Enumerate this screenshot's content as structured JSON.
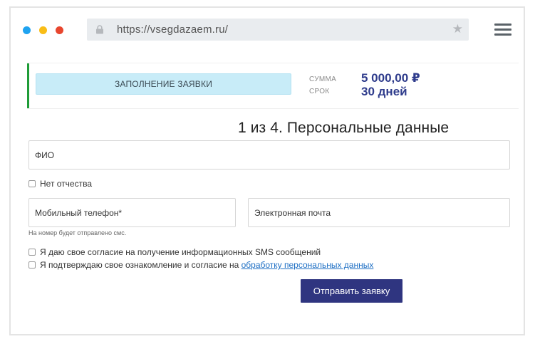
{
  "browser": {
    "url": "https://vsegdazaem.ru/",
    "window_dots": [
      "#1fa3f0",
      "#f9bd16",
      "#e8462e"
    ]
  },
  "summary": {
    "stage_label": "ЗАПОЛНЕНИЕ ЗАЯВКИ",
    "sum_label": "СУММА",
    "sum_value": "5 000,00 ₽",
    "term_label": "СРОК",
    "term_value": "30 дней"
  },
  "form": {
    "step_title": "1 из 4. Персональные данные",
    "fio_placeholder": "ФИО",
    "no_patronymic_label": "Нет отчества",
    "phone_placeholder": "Мобильный телефон*",
    "phone_hint": "На номер будет отправлено смс.",
    "email_placeholder": "Электронная почта",
    "sms_consent_label": "Я даю свое согласие на получение информационных SMS сообщений",
    "pd_consent_prefix": "Я подтверждаю свое ознакомление и согласие на ",
    "pd_consent_link": "обработку персональных данных",
    "submit_label": "Отправить заявку"
  },
  "colors": {
    "accent": "#2f3580",
    "amount": "#2f3c8c",
    "stage_bg": "#c8ecf8",
    "status_bar": "#1f9c38",
    "link": "#1e6fc4"
  }
}
